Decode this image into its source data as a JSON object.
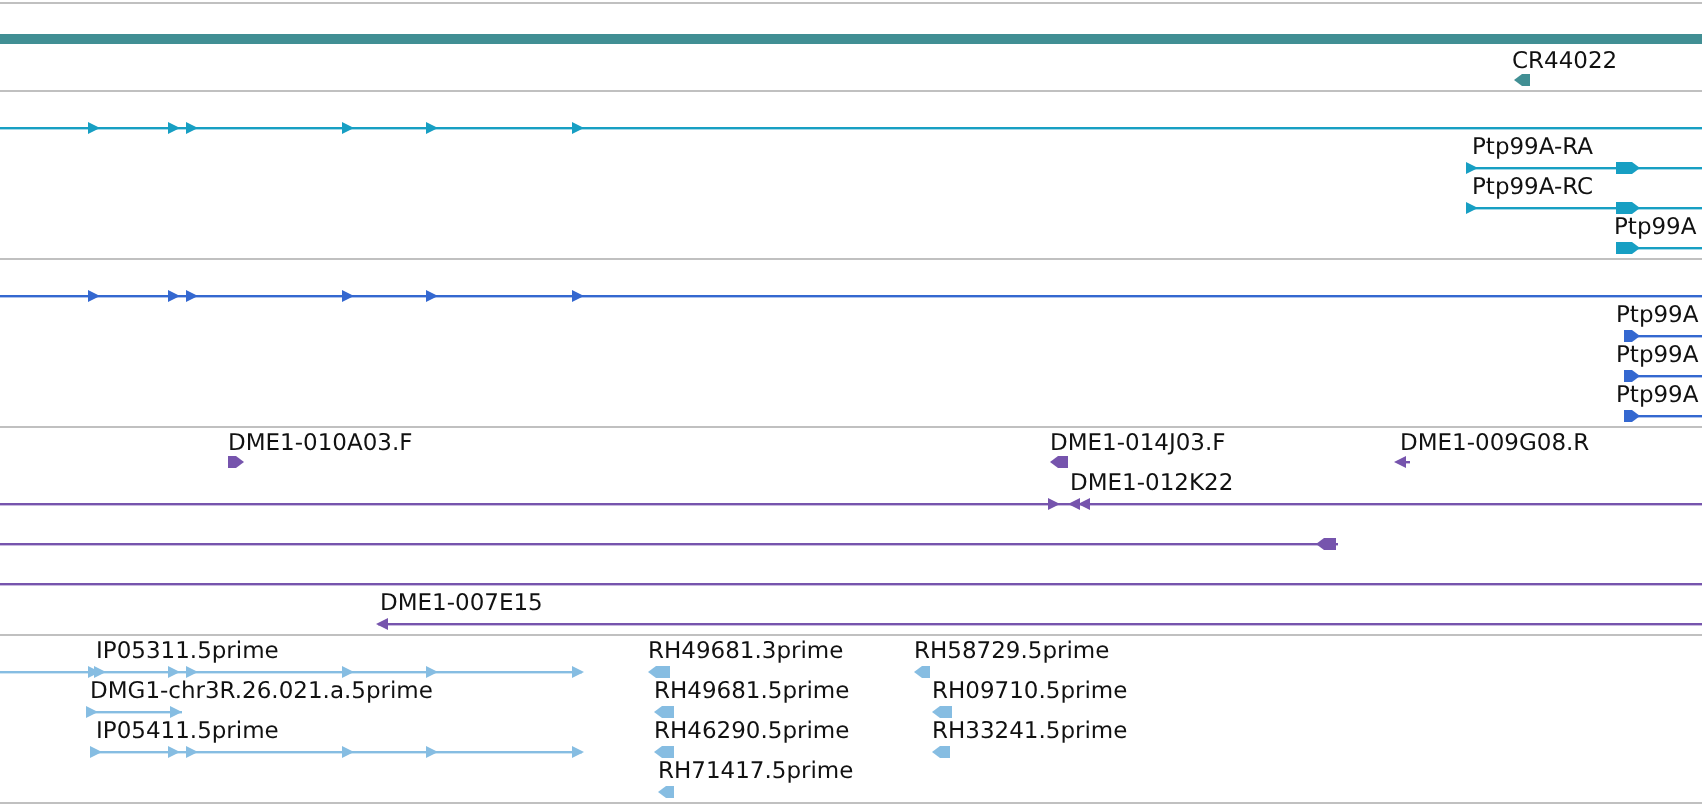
{
  "tracks": [
    {
      "color": "#418f94",
      "features": [
        {
          "kind": "bar"
        },
        {
          "kind": "transcript",
          "label": "CR44022",
          "reverse": true
        }
      ]
    },
    {
      "color": "#179fc3",
      "features": [
        {
          "kind": "transcript",
          "reverse": false
        },
        {
          "kind": "transcript",
          "label": "Ptp99A-RA",
          "reverse": false
        },
        {
          "kind": "transcript",
          "label": "Ptp99A-RC",
          "reverse": false
        },
        {
          "kind": "transcript",
          "label": "Ptp99A",
          "reverse": false
        }
      ]
    },
    {
      "color": "#3468d0",
      "features": [
        {
          "kind": "transcript",
          "reverse": false
        },
        {
          "kind": "transcript",
          "label": "Ptp99A",
          "reverse": false
        },
        {
          "kind": "transcript",
          "label": "Ptp99A",
          "reverse": false
        },
        {
          "kind": "transcript",
          "label": "Ptp99A",
          "reverse": false
        }
      ]
    },
    {
      "color": "#7654ad",
      "features": [
        {
          "kind": "transcript",
          "label": "DME1-010A03.F",
          "reverse": false
        },
        {
          "kind": "transcript",
          "label": "DME1-014J03.F",
          "reverse": true
        },
        {
          "kind": "transcript",
          "label": "DME1-009G08.R",
          "reverse": true
        },
        {
          "kind": "transcript",
          "label": "DME1-012K22",
          "reverse": true
        },
        {
          "kind": "transcript",
          "reverse": true
        },
        {
          "kind": "line"
        },
        {
          "kind": "transcript",
          "label": "DME1-007E15",
          "reverse": true
        }
      ]
    },
    {
      "color": "#86bde2",
      "features": [
        {
          "kind": "transcript",
          "label": "IP05311.5prime",
          "reverse": false
        },
        {
          "kind": "transcript",
          "label": "DMG1-chr3R.26.021.a.5prime",
          "reverse": false
        },
        {
          "kind": "transcript",
          "label": "IP05411.5prime",
          "reverse": false
        },
        {
          "kind": "transcript",
          "label": "RH49681.3prime",
          "reverse": true
        },
        {
          "kind": "transcript",
          "label": "RH49681.5prime",
          "reverse": true
        },
        {
          "kind": "transcript",
          "label": "RH46290.5prime",
          "reverse": true
        },
        {
          "kind": "transcript",
          "label": "RH71417.5prime",
          "reverse": true
        },
        {
          "kind": "transcript",
          "label": "RH58729.5prime",
          "reverse": true
        },
        {
          "kind": "transcript",
          "label": "RH09710.5prime",
          "reverse": true
        },
        {
          "kind": "transcript",
          "label": "RH33241.5prime",
          "reverse": true
        }
      ]
    }
  ]
}
